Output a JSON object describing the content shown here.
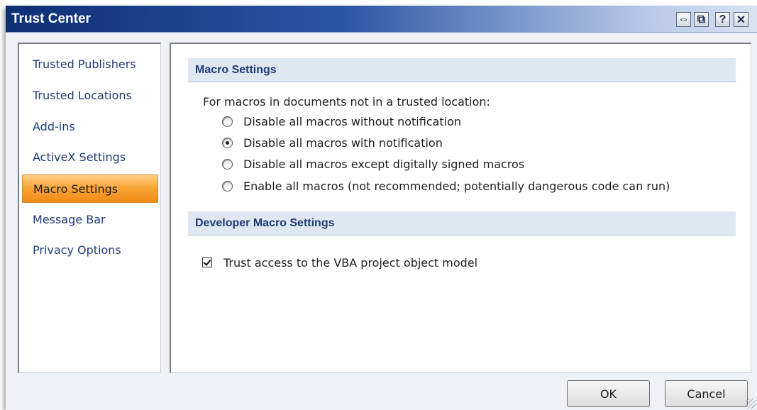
{
  "window": {
    "title": "Trust Center",
    "buttons": [
      {
        "name": "move",
        "glyph": "⇔"
      },
      {
        "name": "restore",
        "glyph": "⧉"
      },
      {
        "name": "help",
        "glyph": "?"
      },
      {
        "name": "close",
        "glyph": "✕"
      }
    ]
  },
  "sidebar": {
    "items": [
      {
        "label": "Trusted Publishers",
        "selected": false
      },
      {
        "label": "Trusted Locations",
        "selected": false
      },
      {
        "label": "Add-ins",
        "selected": false
      },
      {
        "label": "ActiveX Settings",
        "selected": false
      },
      {
        "label": "Macro Settings",
        "selected": true
      },
      {
        "label": "Message Bar",
        "selected": false
      },
      {
        "label": "Privacy Options",
        "selected": false
      }
    ]
  },
  "macro_settings": {
    "header": "Macro Settings",
    "prompt": "For macros in documents not in a trusted location:",
    "options": [
      {
        "label": "Disable all macros without notification",
        "checked": false
      },
      {
        "label": "Disable all macros with notification",
        "checked": true
      },
      {
        "label": "Disable all macros except digitally signed macros",
        "checked": false
      },
      {
        "label": "Enable all macros (not recommended; potentially dangerous code can run)",
        "checked": false
      }
    ]
  },
  "developer_settings": {
    "header": "Developer Macro Settings",
    "vba_label": "Trust access to the VBA project object model",
    "vba_checked": true
  },
  "footer": {
    "ok_label": "OK",
    "cancel_label": "Cancel"
  }
}
